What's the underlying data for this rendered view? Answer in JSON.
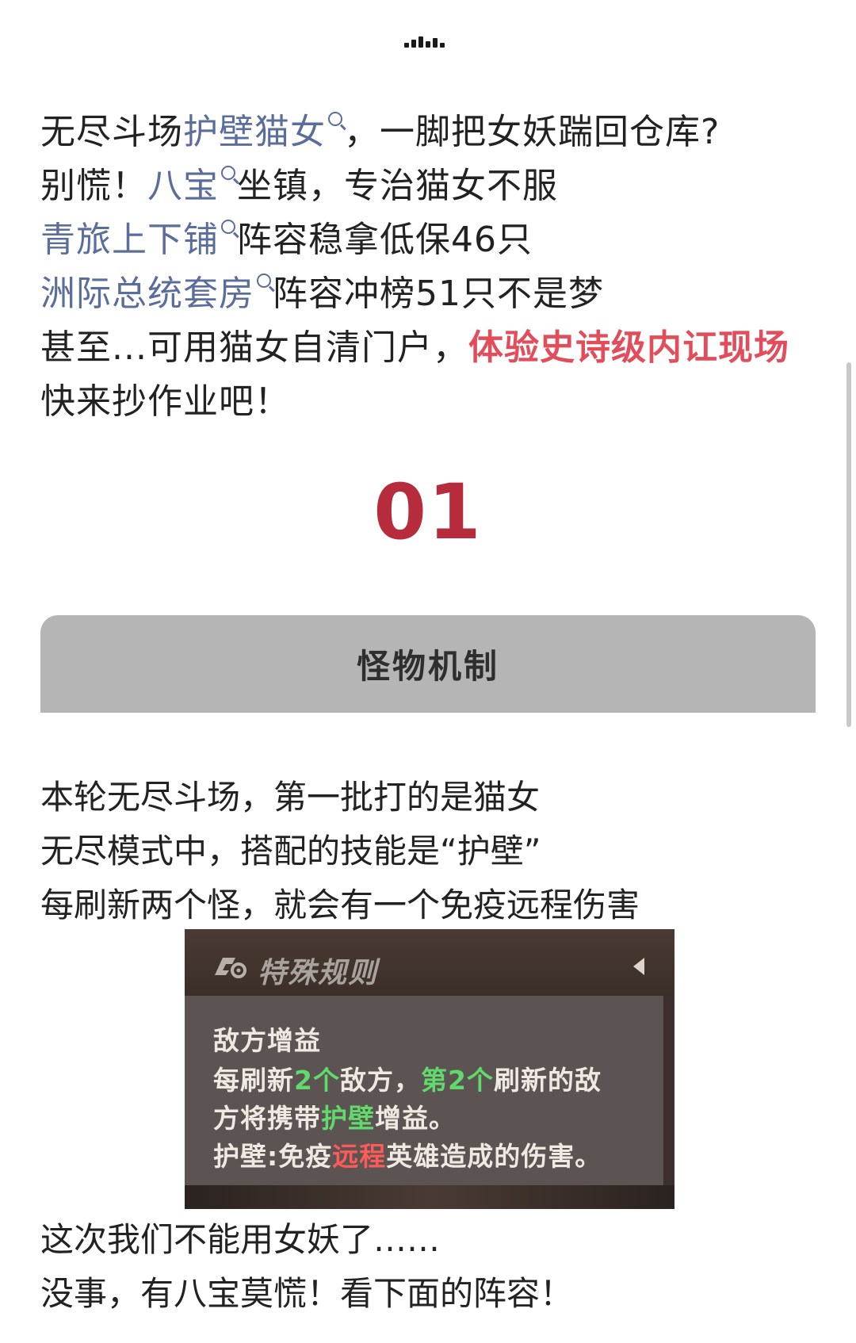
{
  "intro": {
    "line1": {
      "pre": "无尽斗场",
      "kw": "护壁猫女",
      "post": "，一脚把女妖踹回仓库?"
    },
    "line2": {
      "pre": "别慌！",
      "kw": "八宝",
      "post": "坐镇，专治猫女不服"
    },
    "line3": {
      "kw": "青旅上下铺",
      "post": "阵容稳拿低保46只"
    },
    "line4": {
      "kw": "洲际总统套房",
      "post": "阵容冲榜51只不是梦"
    },
    "line5": {
      "pre": "甚至...可用猫女自清门户，",
      "highlight": "体验史诗级内讧现场"
    },
    "line6": "快来抄作业吧！"
  },
  "section": {
    "number": "01",
    "header": "怪物机制"
  },
  "body": {
    "line1": "本轮无尽斗场，第一批打的是猫女",
    "line2": "无尽模式中，搭配的技能是“护壁”",
    "line3": "每刷新两个怪，就会有一个免疫远程伤害"
  },
  "game_screenshot": {
    "title": "特殊规则",
    "panel_title": "敌方增益",
    "row1": {
      "a": "每刷新",
      "b": "2个",
      "c": "敌方，",
      "d": "第2个",
      "e": "刷新的敌"
    },
    "row2": {
      "a": "方将携带",
      "b": "护壁",
      "c": "增益。"
    },
    "row3": {
      "a": "护壁:免疫",
      "b": "远程",
      "c": "英雄造成的伤害。"
    }
  },
  "outro": {
    "line1": "这次我们不能用女妖了……",
    "line2": "没事，有八宝莫慌！看下面的阵容！"
  },
  "colors": {
    "keyword": "#5a6d9b",
    "highlight": "#e24d5c",
    "section_number": "#b62c3c",
    "header_bg": "#b5b5b5"
  }
}
